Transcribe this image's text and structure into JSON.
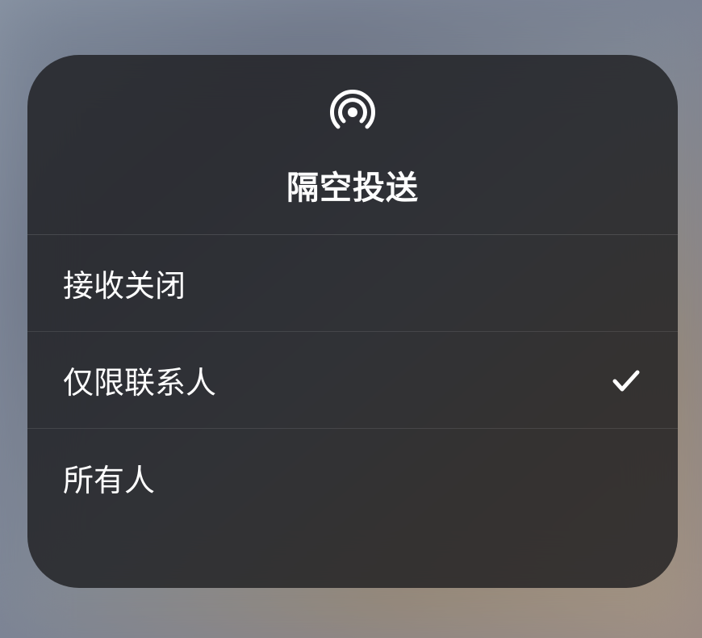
{
  "panel": {
    "title": "隔空投送",
    "icon": "airdrop-icon"
  },
  "options": [
    {
      "label": "接收关闭",
      "selected": false
    },
    {
      "label": "仅限联系人",
      "selected": true
    },
    {
      "label": "所有人",
      "selected": false
    }
  ]
}
